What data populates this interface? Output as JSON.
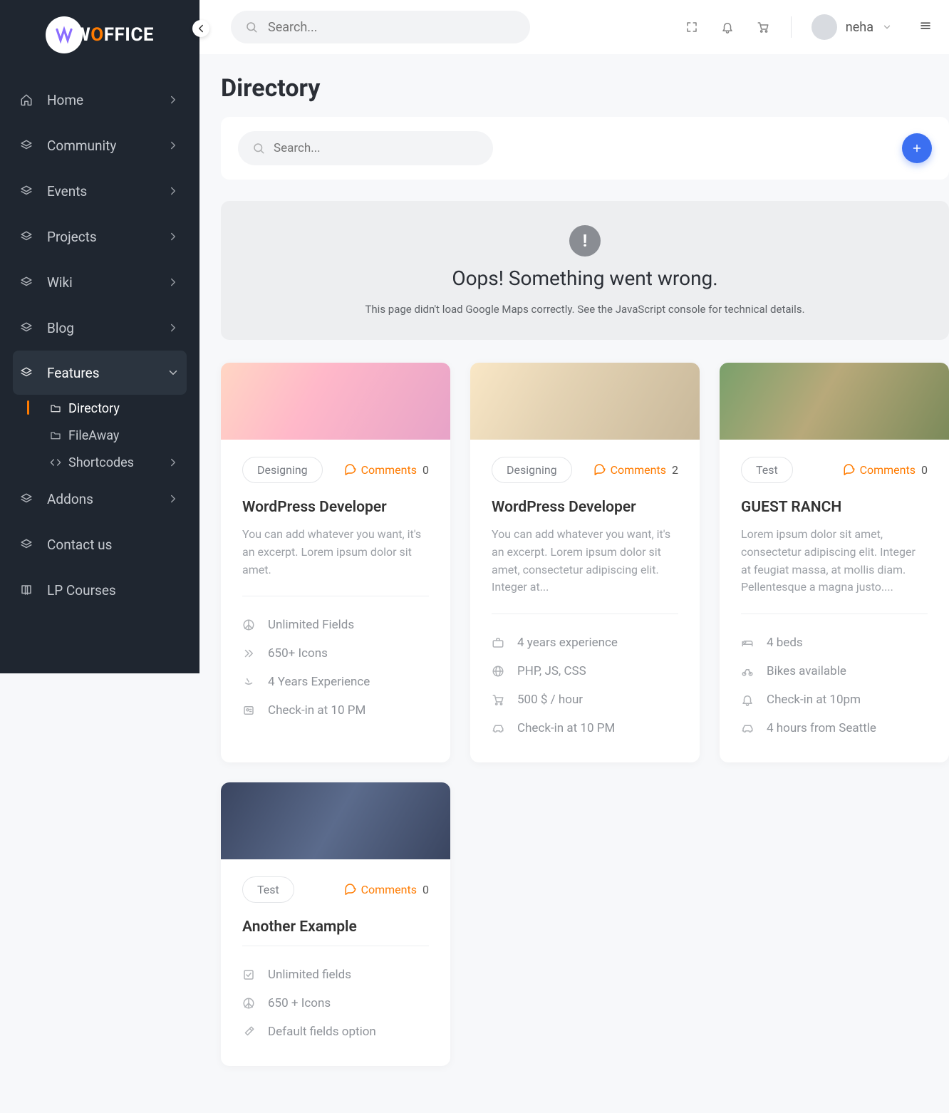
{
  "logo_text_parts": [
    "W",
    "O",
    "FFICE"
  ],
  "sidebar": {
    "items": [
      {
        "icon": "home",
        "label": "Home",
        "chev": true
      },
      {
        "icon": "layers",
        "label": "Community",
        "chev": true
      },
      {
        "icon": "layers",
        "label": "Events",
        "chev": true
      },
      {
        "icon": "layers",
        "label": "Projects",
        "chev": true
      },
      {
        "icon": "layers",
        "label": "Wiki",
        "chev": true
      },
      {
        "icon": "layers",
        "label": "Blog",
        "chev": true
      },
      {
        "icon": "layers",
        "label": "Features",
        "chev": true,
        "active": true,
        "subs": [
          {
            "icon": "folder",
            "label": "Directory",
            "sel": true
          },
          {
            "icon": "folder",
            "label": "FileAway"
          },
          {
            "icon": "code",
            "label": "Shortcodes",
            "chev": true
          }
        ]
      },
      {
        "icon": "layers",
        "label": "Addons",
        "chev": true
      },
      {
        "icon": "layers",
        "label": "Contact us"
      },
      {
        "icon": "book",
        "label": "LP Courses"
      }
    ]
  },
  "topbar": {
    "search_placeholder": "Search...",
    "username": "neha"
  },
  "page": {
    "title": "Directory",
    "tool_search_placeholder": "Search..."
  },
  "map_error": {
    "head": "Oops! Something went wrong.",
    "sub": "This page didn't load Google Maps correctly. See the JavaScript console for technical details."
  },
  "comments_label": "Comments",
  "cards": [
    {
      "img": "a",
      "tag": "Designing",
      "comments": 0,
      "title": "WordPress Developer",
      "excerpt": "You can add whatever you want, it's an excerpt. Lorem ipsum dolor sit amet.",
      "feats": [
        {
          "icon": "peace",
          "text": "Unlimited Fields"
        },
        {
          "icon": "fwd",
          "text": "650+ Icons"
        },
        {
          "icon": "amazon",
          "text": "4 Years Experience"
        },
        {
          "icon": "id",
          "text": "Check-in at 10 PM"
        }
      ]
    },
    {
      "img": "b",
      "tag": "Designing",
      "comments": 2,
      "title": "WordPress Developer",
      "excerpt": "You can add whatever you want, it's an excerpt. Lorem ipsum dolor sit amet, consectetur adipiscing elit. Integer at...",
      "feats": [
        {
          "icon": "briefcase",
          "text": "4 years experience"
        },
        {
          "icon": "globe",
          "text": "PHP, JS, CSS"
        },
        {
          "icon": "cart",
          "text": "500 $ / hour"
        },
        {
          "icon": "car",
          "text": "Check-in at 10 PM"
        }
      ]
    },
    {
      "img": "c",
      "tag": "Test",
      "comments": 0,
      "title": "GUEST RANCH",
      "excerpt": "Lorem ipsum dolor sit amet, consectetur adipiscing elit. Integer at feugiat massa, at mollis diam. Pellentesque a magna justo....",
      "feats": [
        {
          "icon": "bed",
          "text": "4 beds"
        },
        {
          "icon": "bike",
          "text": "Bikes available"
        },
        {
          "icon": "bell",
          "text": "Check-in at 10pm"
        },
        {
          "icon": "car",
          "text": "4 hours from Seattle"
        }
      ]
    },
    {
      "img": "d",
      "tag": "Test",
      "comments": 0,
      "title": "Another Example",
      "excerpt": "",
      "feats": [
        {
          "icon": "check",
          "text": "Unlimited fields"
        },
        {
          "icon": "peace",
          "text": "650 + Icons"
        },
        {
          "icon": "tools",
          "text": "Default fields option"
        }
      ]
    }
  ]
}
